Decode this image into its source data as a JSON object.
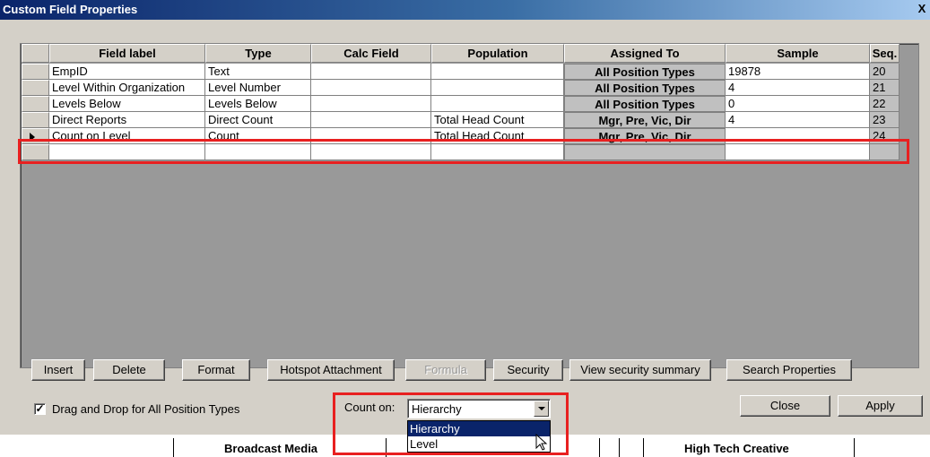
{
  "window": {
    "title": "Custom Field Properties",
    "close_glyph": "X"
  },
  "grid": {
    "columns": [
      "Field label",
      "Type",
      "Calc Field",
      "Population",
      "Assigned To",
      "Sample",
      "Seq."
    ],
    "rows": [
      {
        "field_label": "EmpID",
        "type": "Text",
        "calc_field": "",
        "population": "",
        "assigned_to": "All Position Types",
        "sample": "19878",
        "seq": "20"
      },
      {
        "field_label": "Level Within Organization",
        "type": "Level Number",
        "calc_field": "",
        "population": "",
        "assigned_to": "All Position Types",
        "sample": "4",
        "seq": "21"
      },
      {
        "field_label": "Levels Below",
        "type": "Levels Below",
        "calc_field": "",
        "population": "",
        "assigned_to": "All Position Types",
        "sample": "0",
        "seq": "22"
      },
      {
        "field_label": "Direct Reports",
        "type": "Direct Count",
        "calc_field": "",
        "population": "Total Head Count",
        "assigned_to": "Mgr, Pre, Vic, Dir",
        "sample": "4",
        "seq": "23"
      },
      {
        "field_label": "Count on Level",
        "type": "Count",
        "calc_field": "",
        "population": "Total Head Count",
        "assigned_to": "Mgr, Pre, Vic, Dir",
        "sample": "",
        "seq": "24",
        "selected": true
      }
    ]
  },
  "buttons": {
    "insert": "Insert",
    "delete": "Delete",
    "format": "Format",
    "hotspot": "Hotspot Attachment",
    "formula": "Formula",
    "security": "Security",
    "view_security": "View security summary",
    "search_properties": "Search Properties",
    "close": "Close",
    "apply": "Apply"
  },
  "drag_drop": {
    "checked": true,
    "label": "Drag and Drop for All Position Types"
  },
  "count_on": {
    "label": "Count on:",
    "value": "Hierarchy",
    "options": [
      "Hierarchy",
      "Level"
    ]
  },
  "background": {
    "left_text": "Broadcast Media",
    "right_text": "High Tech Creative"
  },
  "colors": {
    "highlight": "#e82020",
    "title_start": "#0a246a",
    "selection": "#0a246a"
  }
}
